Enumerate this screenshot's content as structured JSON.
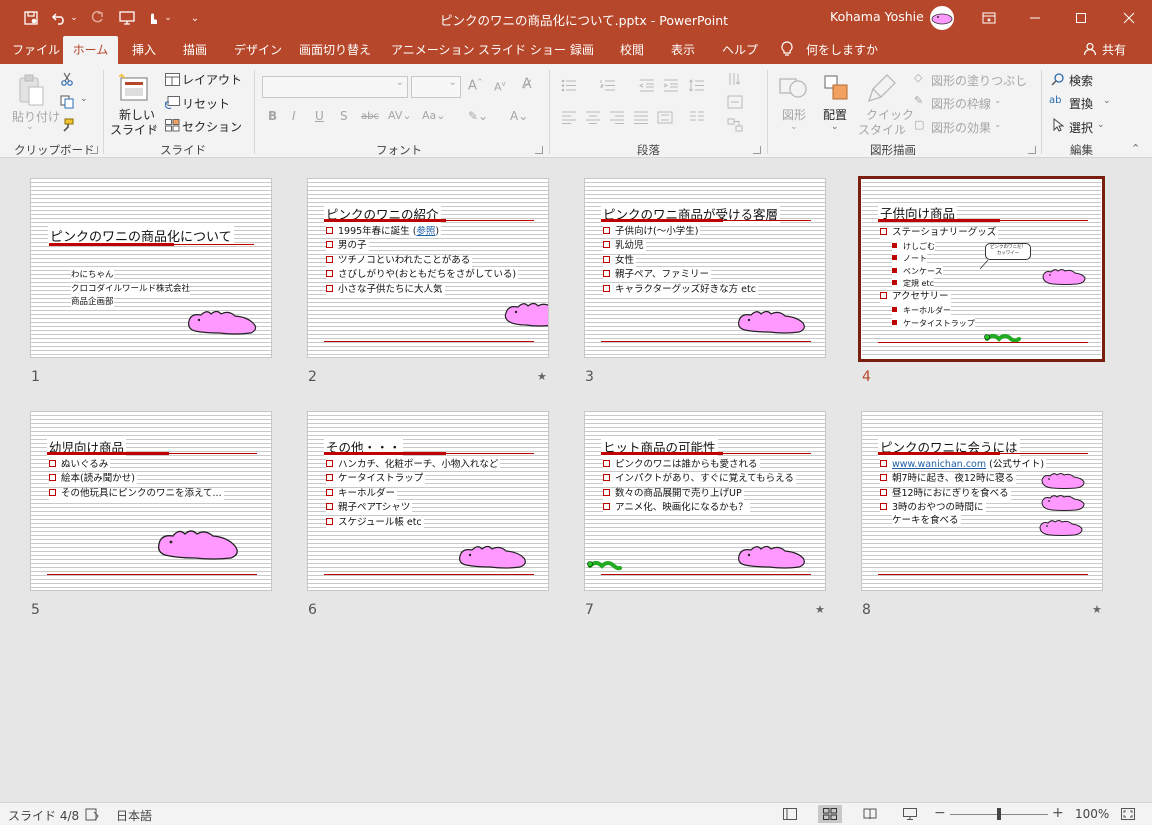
{
  "window": {
    "title": "ピンクのワニの商品化について.pptx  -  PowerPoint",
    "user_name": "Kohama Yoshie",
    "qat_icons": [
      "save-icon",
      "undo-icon",
      "redo-icon",
      "present-from-start-icon",
      "touch-mode-icon",
      "customize-qat-icon"
    ],
    "controls": [
      "ribbon-display-options-icon",
      "minimize-icon",
      "maximize-icon",
      "close-icon"
    ]
  },
  "tabs": [
    "ファイル",
    "ホーム",
    "挿入",
    "描画",
    "デザイン",
    "画面切り替え",
    "アニメーション",
    "スライド ショー",
    "録画",
    "校閲",
    "表示",
    "ヘルプ"
  ],
  "active_tab": "ホーム",
  "tell_me": "何をしますか",
  "share": "共有",
  "ribbon": {
    "clipboard": {
      "paste": "貼り付け",
      "label": "クリップボード"
    },
    "slides": {
      "new_slide_1": "新しい",
      "new_slide_2": "スライド",
      "layout": "レイアウト",
      "reset": "リセット",
      "section": "セクション",
      "label": "スライド"
    },
    "font": {
      "label": "フォント"
    },
    "paragraph": {
      "label": "段落"
    },
    "drawing": {
      "shape": "図形",
      "arrange": "配置",
      "quick_1": "クイック",
      "quick_2": "スタイル",
      "fill": "図形の塗りつぶし",
      "outline": "図形の枠線",
      "effects": "図形の効果",
      "label": "図形描画"
    },
    "editing": {
      "find": "検索",
      "replace": "置換",
      "select": "選択",
      "label": "編集"
    }
  },
  "slides": [
    {
      "num": "1",
      "title": "ピンクのワニの商品化について",
      "meta": [
        "わにちゃん",
        "クロコダイルワールド株式会社",
        "商品企画部"
      ]
    },
    {
      "num": "2",
      "title": "ピンクのワニの紹介",
      "bullets": [
        "1995年春に誕生 (",
        "参照",
        ")",
        "男の子",
        "ツチノコといわれたことがある",
        "さびしがりや(おともだちをさがしている)",
        "小さな子供たちに大人気"
      ],
      "star": "★"
    },
    {
      "num": "3",
      "title": "ピンクのワニ商品が受ける客層",
      "bullets": [
        "子供向け(～小学生)",
        "乳幼児",
        "女性",
        "親子ペア、ファミリー",
        "キャラクターグッズ好きな方 etc"
      ]
    },
    {
      "num": "4",
      "title": "子供向け商品",
      "bullets": [
        "ステーショナリーグッズ",
        "アクセサリー"
      ],
      "subs": [
        "けしごむ",
        "ノート",
        "ペンケース",
        "定規 etc",
        "キーホルダー",
        "ケータイストラップ"
      ],
      "callout": [
        "ピンクのワニだ！",
        "カッワイー"
      ]
    },
    {
      "num": "5",
      "title": "幼児向け商品",
      "bullets": [
        "ぬいぐるみ",
        "絵本(読み聞かせ)",
        "その他玩具にピンクのワニを添えて..."
      ]
    },
    {
      "num": "6",
      "title": "その他・・・",
      "bullets": [
        "ハンカチ、化粧ポーチ、小物入れなど",
        "ケータイストラップ",
        "キーホルダー",
        "親子ペアTシャツ",
        "スケジュール帳 etc"
      ]
    },
    {
      "num": "7",
      "title": "ヒット商品の可能性",
      "bullets": [
        "ピンクのワニは誰からも愛される",
        "インパクトがあり、すぐに覚えてもらえる",
        "数々の商品展開で売り上げUP",
        "アニメ化、映画化になるかも？"
      ],
      "star": "★"
    },
    {
      "num": "8",
      "title": "ピンクのワニに会うには",
      "bullets": [
        "www.wanichan.com",
        " (公式サイト)",
        "朝7時に起き、夜12時に寝る",
        "昼12時におにぎりを食べる",
        "3時のおやつの時間に",
        "ケーキを食べる"
      ],
      "star": "★"
    }
  ],
  "selected_slide": "4",
  "status": {
    "slide": "スライド 4/8",
    "language": "日本語",
    "zoom": "100%"
  },
  "colors": {
    "accent": "#b7472a",
    "croc_pink": "#ff99ff",
    "bullet_red": "#c00000"
  }
}
